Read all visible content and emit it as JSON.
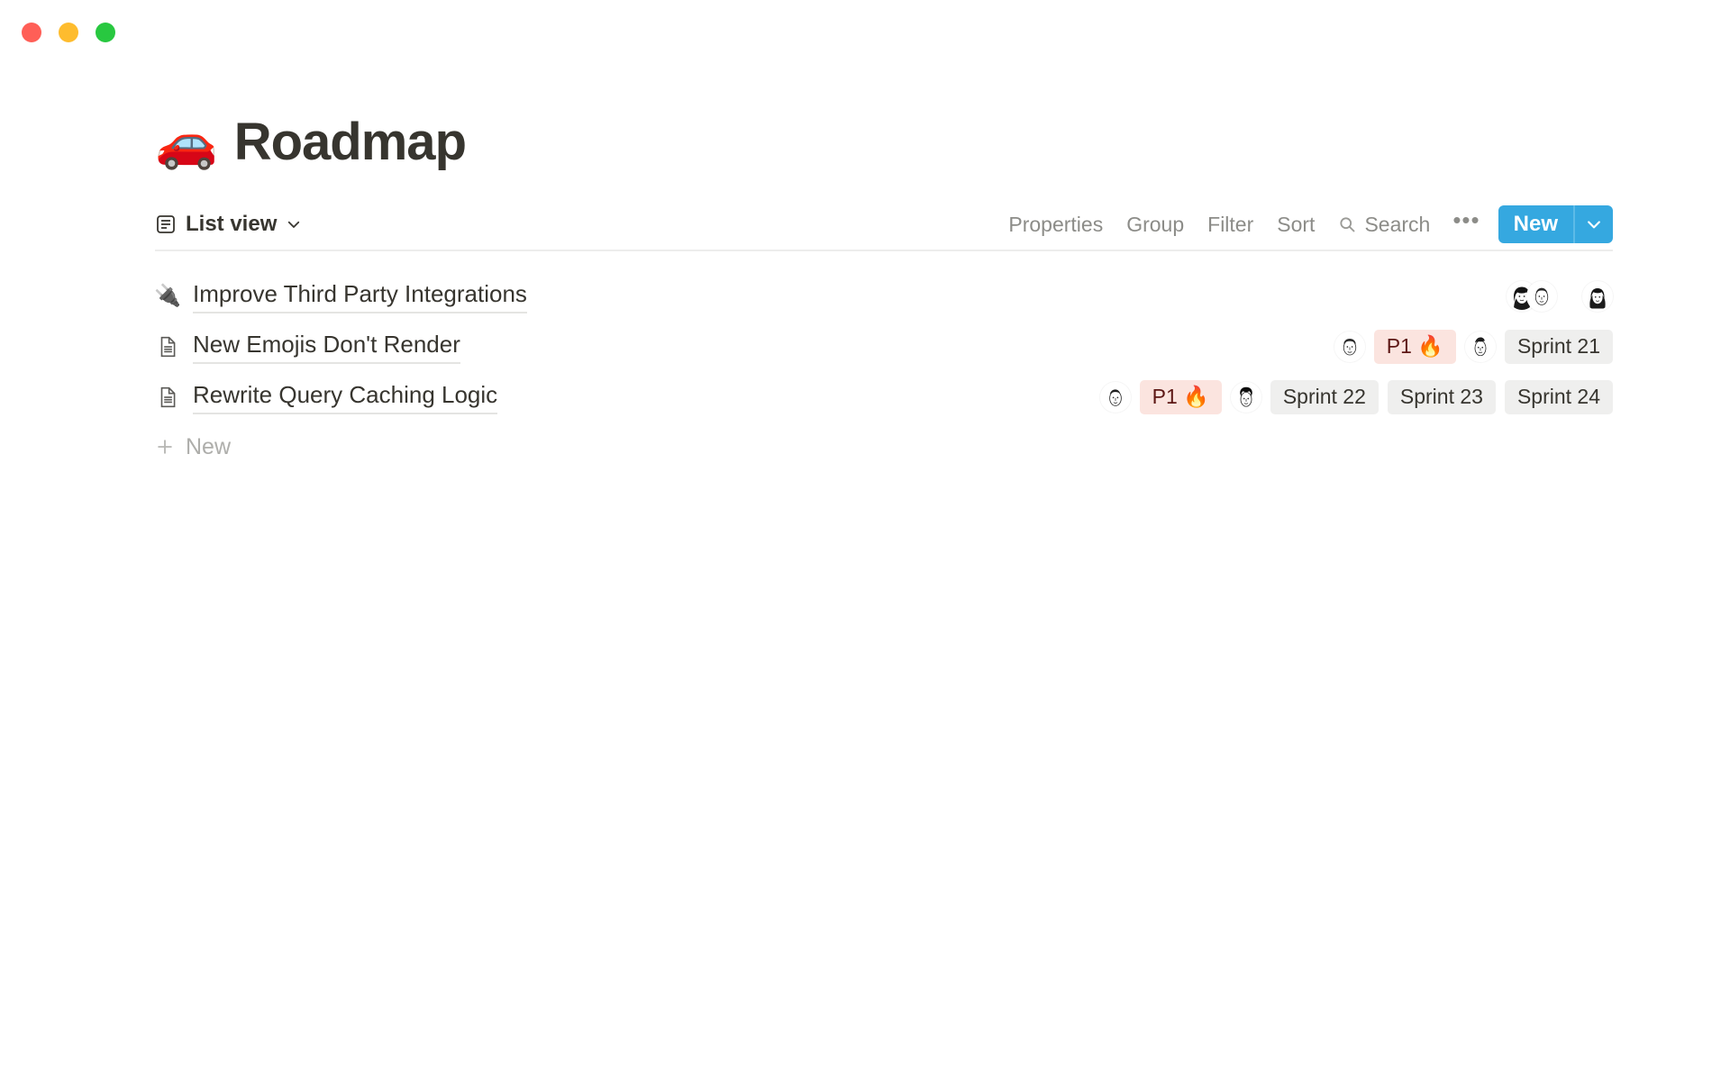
{
  "window": {
    "traffic_lights": [
      {
        "name": "close",
        "color": "#ff5f57"
      },
      {
        "name": "minimize",
        "color": "#febc2e"
      },
      {
        "name": "maximize",
        "color": "#28c840"
      }
    ]
  },
  "page": {
    "emoji": "🚗",
    "title": "Roadmap"
  },
  "toolbar": {
    "view_icon": "list-view-icon",
    "view_name": "List view",
    "view_chevron": "chevron-down-icon",
    "properties_label": "Properties",
    "group_label": "Group",
    "filter_label": "Filter",
    "sort_label": "Sort",
    "search_label": "Search",
    "search_icon": "search-icon",
    "more_label": "•••",
    "new_label": "New",
    "new_caret_icon": "chevron-down-icon",
    "new_button_color": "#35a8e0"
  },
  "list": {
    "rows": [
      {
        "icon": "plug-emoji",
        "emoji": "🔌",
        "title": "Improve Third Party Integrations",
        "avatars_grouped": [
          "avatar-woman-dark-hair",
          "avatar-man-short-hair"
        ],
        "tags": [],
        "avatars_trailing": [
          "avatar-woman-long-hair"
        ]
      },
      {
        "icon": "page-icon",
        "emoji": "",
        "title": "New Emojis Don't Render",
        "avatars_leading": [
          "avatar-man-round-face"
        ],
        "priority": "P1 🔥",
        "avatars_mid": [
          "avatar-man-quiff"
        ],
        "sprints": [
          "Sprint 21"
        ]
      },
      {
        "icon": "page-icon",
        "emoji": "",
        "title": "Rewrite Query Caching Logic",
        "avatars_leading": [
          "avatar-man-side-part"
        ],
        "priority": "P1 🔥",
        "avatars_mid": [
          "avatar-man-curly-hair"
        ],
        "sprints": [
          "Sprint 22",
          "Sprint 23",
          "Sprint 24"
        ]
      }
    ],
    "new_row_label": "New",
    "new_row_icon": "plus-icon"
  },
  "colors": {
    "accent": "#35a8e0",
    "priority_bg": "#fbe4df",
    "priority_text": "#5d1715",
    "sprint_bg": "#efefee",
    "text": "#37352f"
  }
}
